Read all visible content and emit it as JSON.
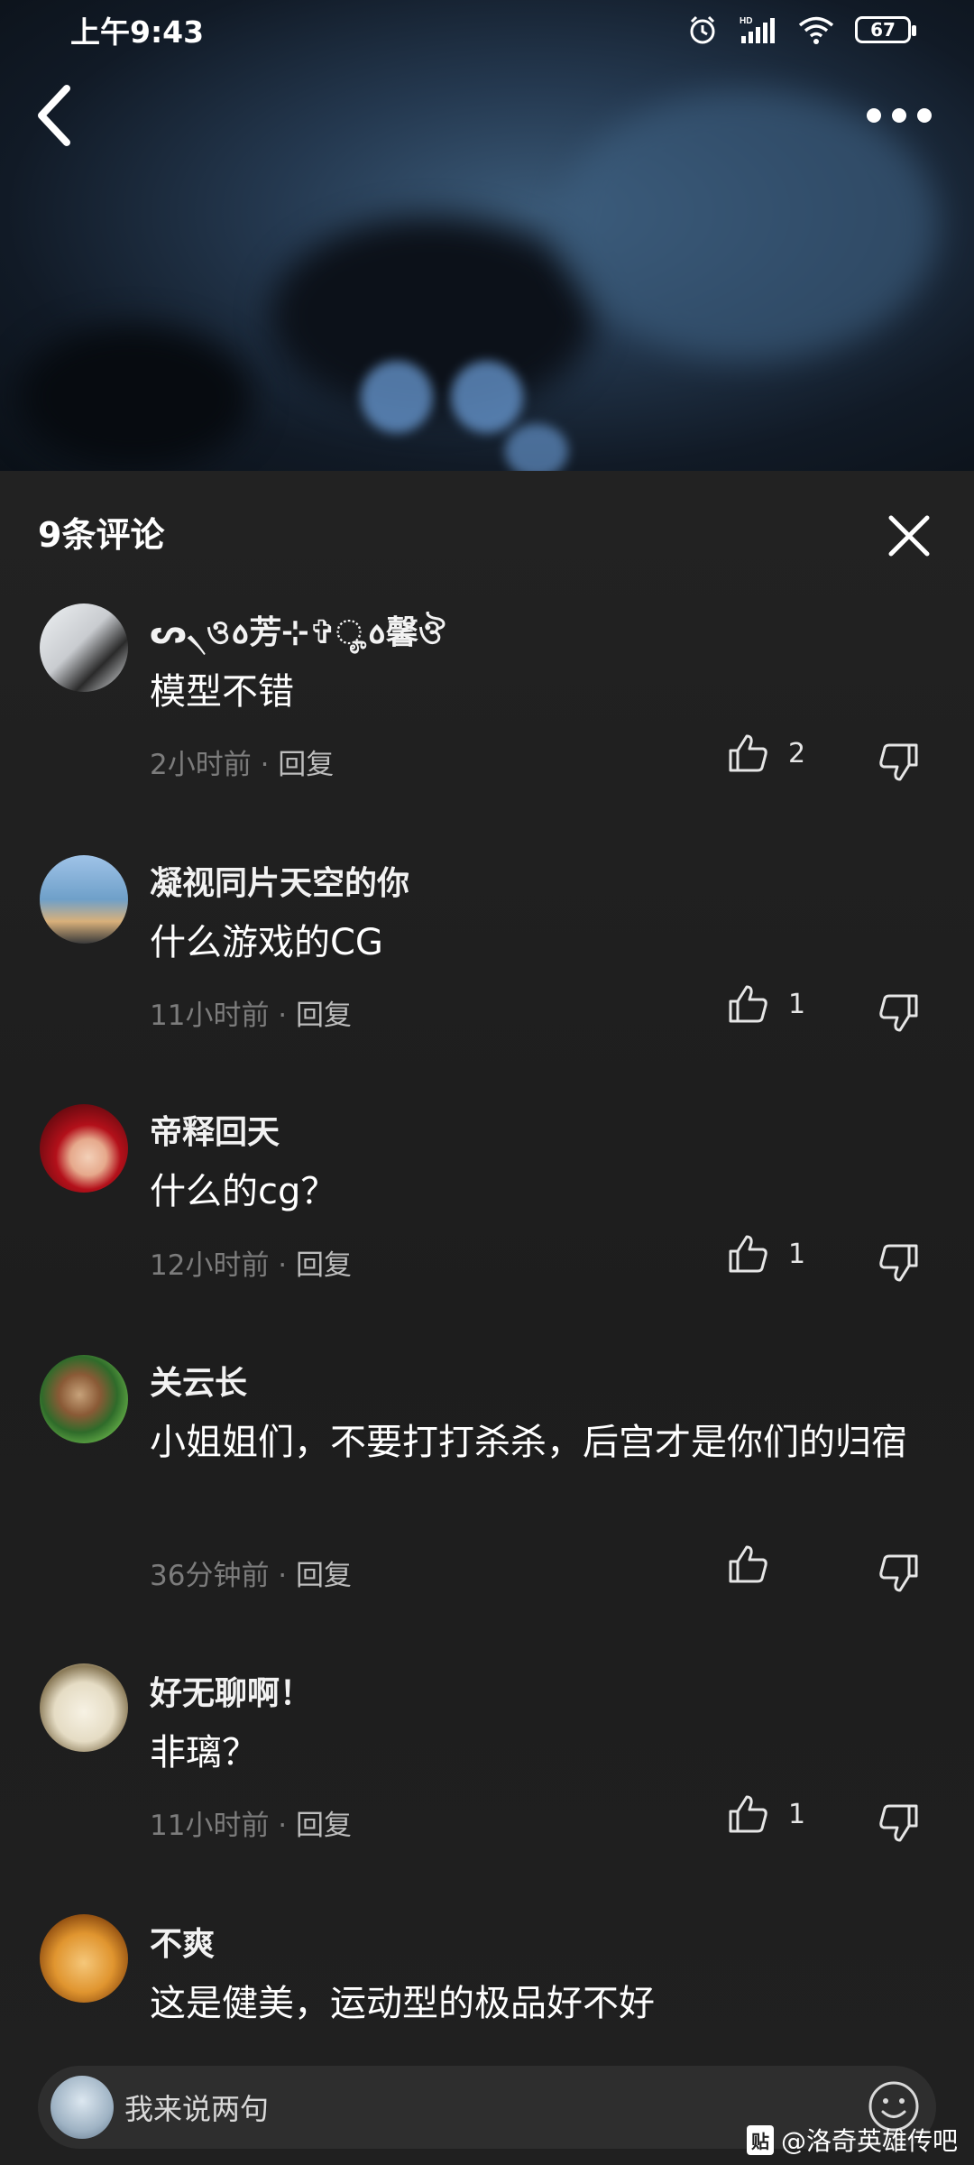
{
  "status_bar": {
    "time": "上午9:43",
    "battery": "67"
  },
  "panel": {
    "title": "9条评论"
  },
  "comments": [
    {
      "username": "ᔕ৲ও꧞芳⊹✞ೄ꧞馨ঔ",
      "text": "模型不错",
      "time": "2小时前",
      "reply": "回复",
      "likes": "2"
    },
    {
      "username": "凝视同片天空的你",
      "text": "什么游戏的CG",
      "time": "11小时前",
      "reply": "回复",
      "likes": "1"
    },
    {
      "username": "帝释回天",
      "text": "什么的cg？",
      "time": "12小时前",
      "reply": "回复",
      "likes": "1"
    },
    {
      "username": "关云长",
      "text": "小姐姐们，不要打打杀杀，后宫才是你们的归宿",
      "time": "36分钟前",
      "reply": "回复",
      "likes": ""
    },
    {
      "username": "好无聊啊！",
      "text": "非璃？",
      "time": "11小时前",
      "reply": "回复",
      "likes": "1"
    },
    {
      "username": "不爽",
      "text": "这是健美，运动型的极品好不好"
    }
  ],
  "input": {
    "placeholder": "我来说两句"
  },
  "watermark": {
    "badge": "贴",
    "text": "@洛奇英雄传吧"
  },
  "colors": {
    "background": "#1f1f1f",
    "meta": "#7c7c7c"
  }
}
